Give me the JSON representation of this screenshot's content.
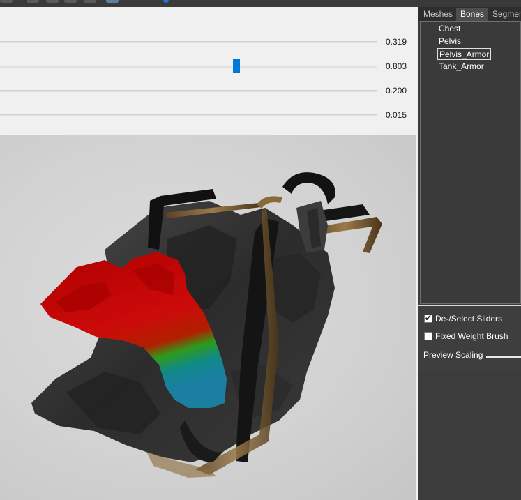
{
  "sliders": [
    {
      "value": "0.319",
      "level": 0.0
    },
    {
      "value": "0.803",
      "level": 0.62
    },
    {
      "value": "0.200",
      "level": 0.0
    },
    {
      "value": "0.015",
      "level": 0.0
    }
  ],
  "tabs": [
    "Meshes",
    "Bones",
    "Segmen"
  ],
  "active_tab": "Bones",
  "bones": [
    "Chest",
    "Pelvis",
    "Pelvis_Armor",
    "Tank_Armor"
  ],
  "selected_bone": "Pelvis_Armor",
  "options": {
    "deselect_sliders": {
      "label": "De-/Select Sliders",
      "checked": true
    },
    "fixed_weight_brush": {
      "label": "Fixed Weight Brush",
      "checked": false
    },
    "preview_scaling_label": "Preview Scaling"
  },
  "colors": {
    "accent": "#0078d7",
    "weight_high": "#cc0000",
    "weight_low": "#0099cc"
  }
}
